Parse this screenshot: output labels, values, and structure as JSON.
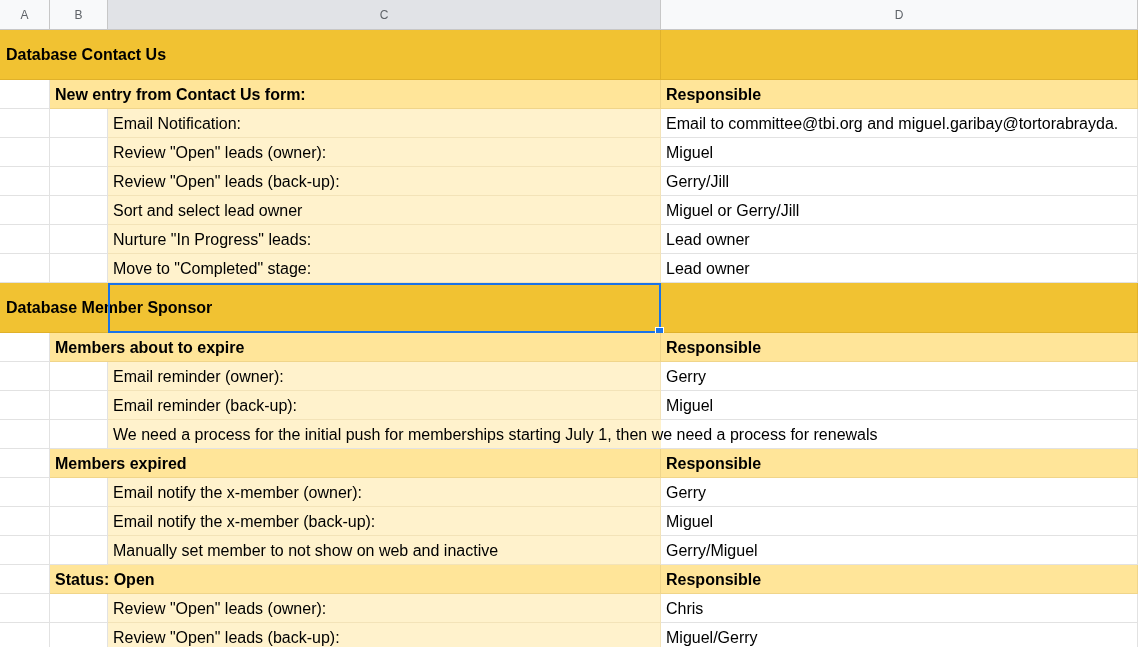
{
  "columns": [
    {
      "label": "A",
      "selected": false
    },
    {
      "label": "B",
      "selected": false
    },
    {
      "label": "C",
      "selected": true
    },
    {
      "label": "D",
      "selected": false
    }
  ],
  "rows": [
    {
      "kind": "section",
      "text": "Database Contact Us",
      "selected": false
    },
    {
      "kind": "group",
      "text": "New entry from Contact Us form:",
      "responsible": "Responsible",
      "selected": false
    },
    {
      "kind": "item",
      "text": "Email Notification:",
      "value": "Email to committee@tbi.org and miguel.garibay@tortorabrayda.",
      "selected": false
    },
    {
      "kind": "item",
      "text": "Review \"Open\" leads (owner):",
      "value": "Miguel",
      "selected": false
    },
    {
      "kind": "item",
      "text": "Review \"Open\" leads (back-up):",
      "value": "Gerry/Jill",
      "selected": false
    },
    {
      "kind": "item",
      "text": "Sort and select lead owner",
      "value": "Miguel or Gerry/Jill",
      "selected": false
    },
    {
      "kind": "item",
      "text": "Nurture \"In Progress\" leads:",
      "value": "Lead owner",
      "selected": false
    },
    {
      "kind": "item",
      "text": "Move to \"Completed\" stage:",
      "value": "Lead owner",
      "selected": false
    },
    {
      "kind": "section",
      "text": "Database Member Sponsor",
      "selected": true
    },
    {
      "kind": "group",
      "text": "Members about to expire",
      "responsible": "Responsible",
      "selected": false
    },
    {
      "kind": "item",
      "text": "Email reminder (owner):",
      "value": "Gerry",
      "selected": false
    },
    {
      "kind": "item",
      "text": "Email reminder (back-up):",
      "value": "Miguel",
      "selected": false
    },
    {
      "kind": "note",
      "text": "We need a process for the initial push for memberships starting July 1, then we need a process for renewals",
      "selected": false
    },
    {
      "kind": "group",
      "text": "Members expired",
      "responsible": "Responsible",
      "selected": false
    },
    {
      "kind": "item",
      "text": "Email notify the x-member (owner):",
      "value": "Gerry",
      "selected": false
    },
    {
      "kind": "item",
      "text": "Email notify the x-member (back-up):",
      "value": "Miguel",
      "selected": false
    },
    {
      "kind": "item",
      "text": "Manually set member to not show on web and inactive",
      "value": "Gerry/Miguel",
      "selected": false
    },
    {
      "kind": "group",
      "text": "Status: Open",
      "responsible": "Responsible",
      "selected": false
    },
    {
      "kind": "item",
      "text": "Review \"Open\" leads (owner):",
      "value": "Chris",
      "selected": false
    },
    {
      "kind": "item",
      "text": "Review \"Open\" leads (back-up):",
      "value": "Miguel/Gerry",
      "selected": false
    }
  ]
}
